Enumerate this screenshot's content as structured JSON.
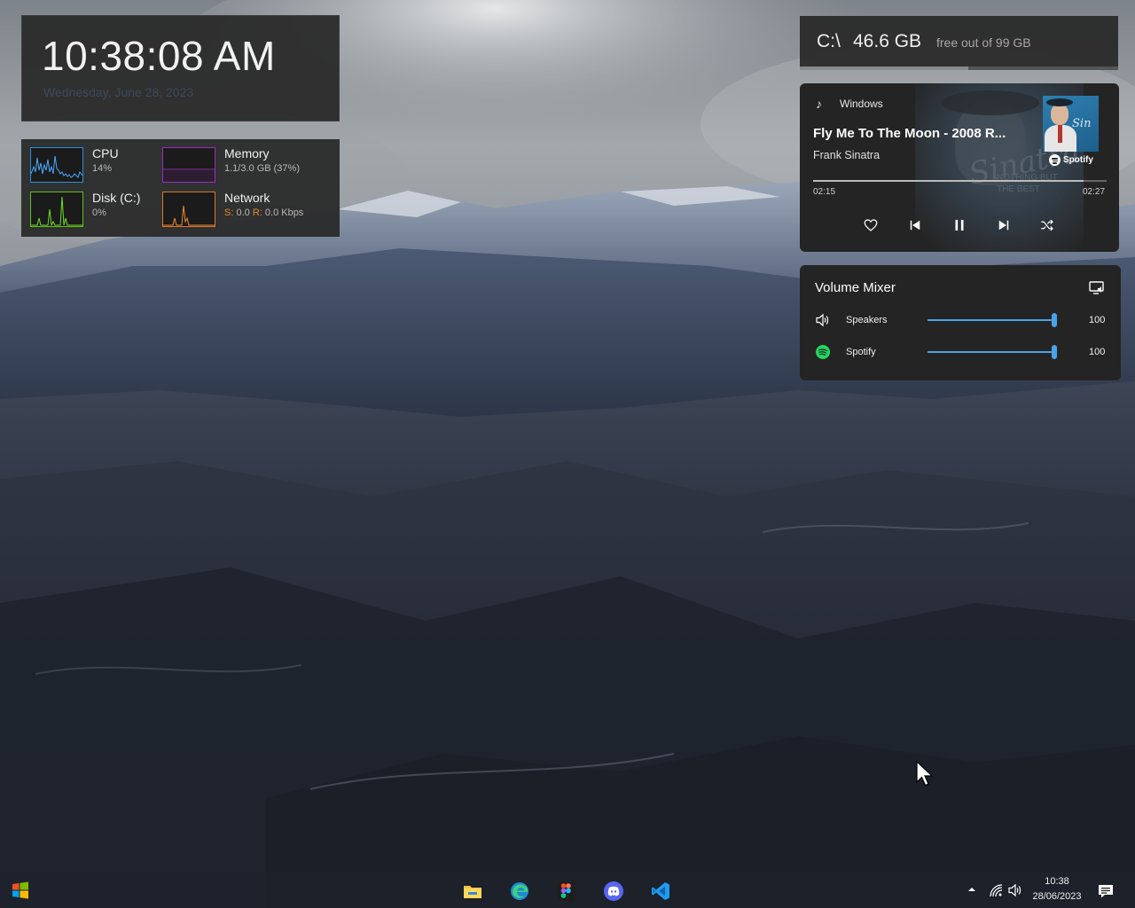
{
  "clock": {
    "time": "10:38:08 AM",
    "date": "Wednesday, June 28, 2023"
  },
  "performance": {
    "cpu": {
      "title": "CPU",
      "value": "14%",
      "color": "#2e8fd8",
      "percent": 14
    },
    "memory": {
      "title": "Memory",
      "value": "1.1/3.0 GB (37%)",
      "color": "#9b2fbf",
      "percent": 37
    },
    "disk": {
      "title": "Disk (C:)",
      "value": "0%",
      "color": "#5cc21a",
      "percent": 0
    },
    "network": {
      "title": "Network",
      "send_label": "S:",
      "send_value": "0.0",
      "recv_label": "R:",
      "recv_value": "0.0 Kbps",
      "color": "#d9782a"
    }
  },
  "storage": {
    "drive": "C:\\",
    "free": "46.6 GB",
    "caption": "free out of 99 GB",
    "used_fraction": 0.53
  },
  "media": {
    "app": "Windows",
    "title": "Fly Me To The Moon - 2008 R...",
    "artist": "Frank Sinatra",
    "source": "Spotify",
    "elapsed": "02:15",
    "total": "02:27",
    "progress_fraction": 0.92,
    "album_signature": "Sinatra",
    "album_subtitle_1": "NOTHING BUT",
    "album_subtitle_2": "THE BEST",
    "controls": [
      "heart-icon",
      "previous-icon",
      "pause-icon",
      "next-icon",
      "shuffle-icon"
    ]
  },
  "volume_mixer": {
    "title": "Volume Mixer",
    "rows": [
      {
        "label": "Speakers",
        "value": "100",
        "level": 1.0,
        "icon": "speaker-icon"
      },
      {
        "label": "Spotify",
        "value": "100",
        "level": 1.0,
        "icon": "spotify-icon"
      }
    ],
    "accent": "#4aa3e8"
  },
  "taskbar": {
    "apps": [
      "file-explorer-icon",
      "edge-icon",
      "figma-icon",
      "discord-icon",
      "vscode-icon"
    ],
    "time": "10:38",
    "date": "28/06/2023"
  }
}
